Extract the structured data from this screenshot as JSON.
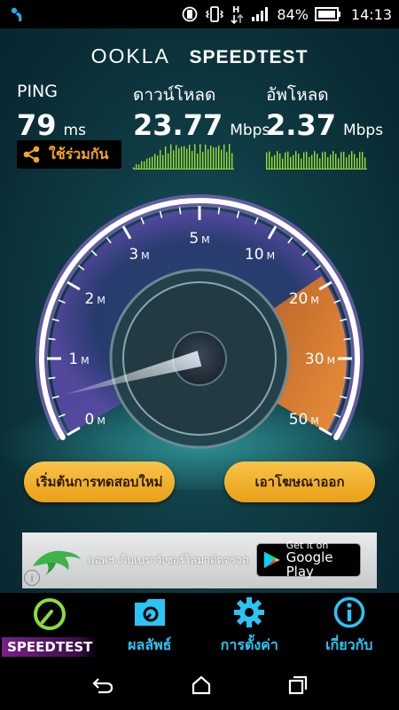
{
  "status_bar": {
    "battery_percent": "84%",
    "time": "14:13"
  },
  "header": {
    "brand_left": "OOKLA",
    "brand_right": "SPEEDTEST"
  },
  "metrics": {
    "ping": {
      "label": "PING",
      "value": "79",
      "unit": "ms"
    },
    "download": {
      "label": "ดาวน์โหลด",
      "value": "23.77",
      "unit": "Mbps"
    },
    "upload": {
      "label": "อัพโหลด",
      "value": "2.37",
      "unit": "Mbps"
    }
  },
  "share_button": {
    "label": "ใช้ร่วมกัน",
    "icon": "share-icon"
  },
  "gauge": {
    "ticks": [
      {
        "label": "0",
        "unit": "M"
      },
      {
        "label": "1",
        "unit": "M"
      },
      {
        "label": "2",
        "unit": "M"
      },
      {
        "label": "3",
        "unit": "M"
      },
      {
        "label": "5",
        "unit": "M"
      },
      {
        "label": "10",
        "unit": "M"
      },
      {
        "label": "20",
        "unit": "M"
      },
      {
        "label": "30",
        "unit": "M"
      },
      {
        "label": "50",
        "unit": "M"
      }
    ],
    "needle_value_mbps": 0.5,
    "colors": {
      "ring": "#ffffff",
      "glow": "#9a6fe0",
      "upper_band": "#f08a24"
    }
  },
  "actions": {
    "retest_label": "เริ่มต้นการทดสอบใหม่",
    "remove_ads_label": "เอาโฆษณาออก"
  },
  "ad": {
    "text": "แอพฯ เว็บเบราว์เซอร์โลมาติดจรวด",
    "store_line1": "Get it on",
    "store_line2": "Google Play",
    "info_icon": "i"
  },
  "tabs": [
    {
      "label": "SPEEDTEST",
      "icon": "gauge-icon",
      "active": true
    },
    {
      "label": "ผลลัพธ์",
      "icon": "folder-icon",
      "active": false
    },
    {
      "label": "การตั้งค่า",
      "icon": "gear-icon",
      "active": false
    },
    {
      "label": "เกี่ยวกับ",
      "icon": "info-icon",
      "active": false
    }
  ],
  "colors": {
    "accent_orange": "#f7a51c",
    "tab_blue": "#29c5f6",
    "spark_green": "#9be032",
    "active_green": "#8bdc3c"
  }
}
